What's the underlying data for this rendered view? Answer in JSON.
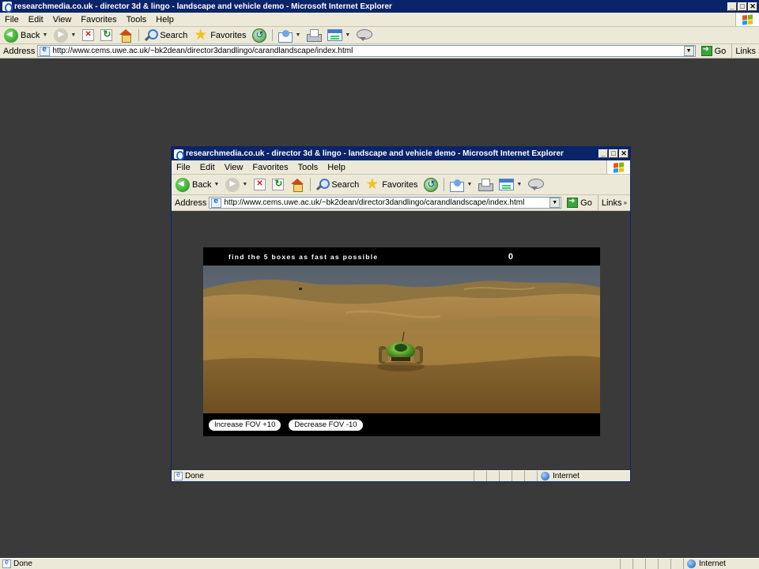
{
  "outer": {
    "title": "researchmedia.co.uk - director 3d & lingo - landscape and vehicle demo - Microsoft Internet Explorer",
    "menu": [
      "File",
      "Edit",
      "View",
      "Favorites",
      "Tools",
      "Help"
    ],
    "toolbar": {
      "back": "Back",
      "search": "Search",
      "favorites": "Favorites"
    },
    "address": {
      "label": "Address",
      "url": "http://www.cems.uwe.ac.uk/~bk2dean/director3dandlingo/carandlandscape/index.html",
      "go": "Go",
      "links": "Links"
    },
    "status": {
      "text": "Done",
      "zone": "Internet"
    }
  },
  "inner": {
    "title": "researchmedia.co.uk - director 3d & lingo - landscape and vehicle demo - Microsoft Internet Explorer",
    "menu": [
      "File",
      "Edit",
      "View",
      "Favorites",
      "Tools",
      "Help"
    ],
    "toolbar": {
      "back": "Back",
      "search": "Search",
      "favorites": "Favorites"
    },
    "address": {
      "label": "Address",
      "url": "http://www.cems.uwe.ac.uk/~bk2dean/director3dandlingo/carandlandscape/index.html",
      "go": "Go",
      "links": "Links"
    },
    "status": {
      "text": "Done",
      "zone": "Internet"
    }
  },
  "game": {
    "instruction": "find the 5 boxes as fast as possible",
    "score": "0",
    "buttons": {
      "increase_fov": "Increase FOV +10",
      "decrease_fov": "Decrease FOV -10"
    }
  },
  "colors": {
    "titlebar": "#0a246a",
    "desktop": "#3a3a3a",
    "sky": "#5f6a78",
    "sand": "#a8813f"
  }
}
